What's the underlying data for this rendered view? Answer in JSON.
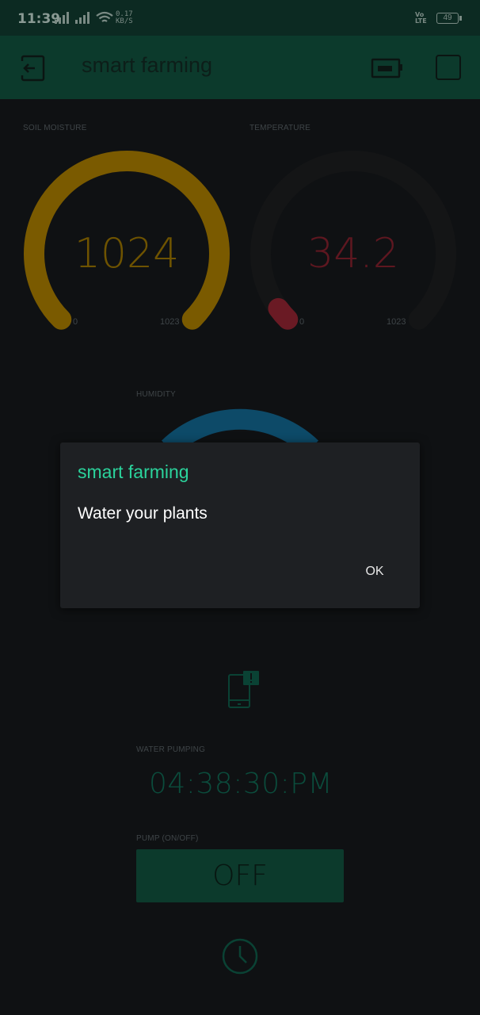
{
  "status_bar": {
    "time": "11:39",
    "speed_value": "0.17",
    "speed_unit": "KB/S",
    "volte_top": "Vo",
    "volte_bottom": "LTE",
    "battery": "49"
  },
  "app_bar": {
    "title": "smart farming"
  },
  "soil_moisture": {
    "label": "SOIL MOISTURE",
    "value": "1024",
    "min": "0",
    "max": "1023",
    "level": 1.0,
    "color": "#7a5a00"
  },
  "temperature": {
    "label": "TEMPERATURE",
    "value": "34.2",
    "min": "0",
    "max": "1023",
    "level": 0.033,
    "color": "#6a1a24"
  },
  "humidity": {
    "label": "HUMIDITY",
    "color": "#0d5070"
  },
  "water_pumping": {
    "label": "WATER PUMPING",
    "value": "04:38:30:PM"
  },
  "pump": {
    "label": "PUMP (ON/OFF)",
    "state": "OFF"
  },
  "dialog": {
    "title": "smart farming",
    "message": "Water your plants",
    "ok_label": "OK"
  }
}
